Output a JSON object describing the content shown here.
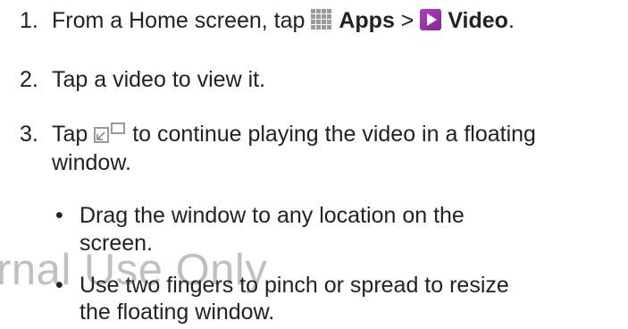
{
  "steps": [
    {
      "num": "1.",
      "text_a": "From a Home screen, tap",
      "icon_apps": "apps-grid-icon",
      "label_apps": "Apps",
      "sep": ">",
      "icon_video": "video-play-icon",
      "label_video": "Video",
      "end": "."
    },
    {
      "num": "2.",
      "text": "Tap a video to view it."
    },
    {
      "num": "3.",
      "text_a": "Tap",
      "icon": "popup-play-icon",
      "text_b": "to continue playing the video in a floating",
      "text_c": "window."
    }
  ],
  "bullets": [
    {
      "mark": "•",
      "line1": "Drag the window to any location on the",
      "line2": "screen."
    },
    {
      "mark": "•",
      "line1": "Use two fingers to pinch or spread to resize",
      "line2": "the floating window."
    }
  ],
  "watermark": "rnal Use Only",
  "colors": {
    "text": "#222222",
    "video_icon": "#9b2fa8",
    "apps_icon": "#9a9a9a",
    "watermark": "#8c8c8c"
  }
}
